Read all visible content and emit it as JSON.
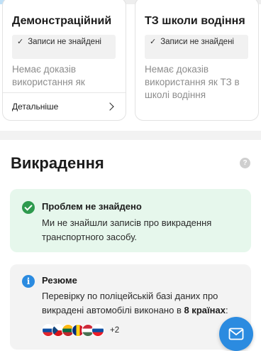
{
  "progress": {
    "fraction": 0.38
  },
  "cards": [
    {
      "title": "Демонстраційний",
      "badge": "Записи не знайдені",
      "desc": "Немає доказів використання як",
      "details": "Детальніше"
    },
    {
      "title": "ТЗ школи водіння",
      "badge": "Записи не знайдені",
      "desc": "Немає доказів використання як ТЗ в школі водіння"
    }
  ],
  "theft": {
    "title": "Викрадення",
    "help": "?",
    "ok": {
      "title": "Проблем не знайдено",
      "text": "Ми не знайшли записів про викрадення транспортного засобу."
    },
    "summary": {
      "title": "Резюме",
      "text_prefix": "Перевірку по поліцейській базі даних про викрадені автомобілі виконано в ",
      "text_bold": "8 країнах",
      "text_suffix": ":",
      "flags": [
        "SI",
        "CZ",
        "LT",
        "RO",
        "HU",
        "SK"
      ],
      "more": "+2"
    }
  },
  "icons": {
    "check": "check-icon",
    "chevron": "chevron-right-icon",
    "help": "question-icon",
    "ok": "check-circle-icon",
    "info": "info-icon",
    "mail": "mail-icon"
  },
  "colors": {
    "success_bg": "#e6f7ec",
    "success_icon": "#2e9a4e",
    "info": "#2b8be0"
  }
}
